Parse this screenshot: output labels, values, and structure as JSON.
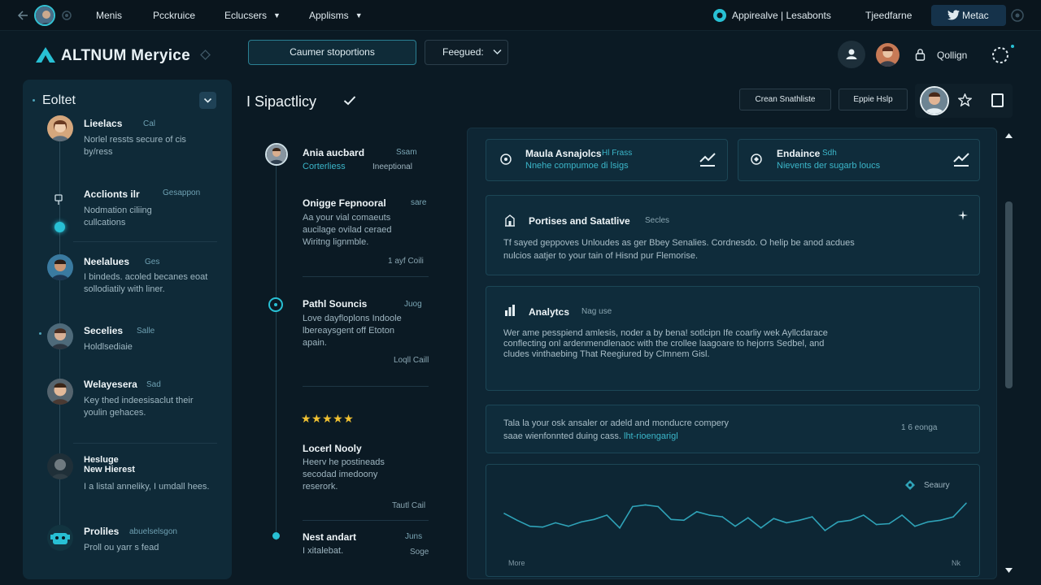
{
  "nav": {
    "items": [
      "Menis",
      "Pcckruice",
      "Eclucsers",
      "Applisms"
    ],
    "right_link": "Appirealve | Lesabonts",
    "right_link2": "Tjeedfarne",
    "twitter_label": "Metac"
  },
  "header": {
    "app_name": "ALTNUM Meryice",
    "primary_button": "Caumer stoportions",
    "select_label": "Feegued:",
    "login_label": "Qollign"
  },
  "sidebar": {
    "title": "Eoltet",
    "items": [
      {
        "name": "Lieelacs",
        "meta": "Cal",
        "desc": "Norlel ressts secure of cis by/ress"
      },
      {
        "name": "Acclionts ilr",
        "meta": "Gesappon",
        "desc": "Nodmation ciliing cullcations"
      },
      {
        "name": "Neelalues",
        "meta": "Ges",
        "desc": "I bindeds. acoled becanes eoat sollodiatily with liner."
      },
      {
        "name": "Secelies",
        "meta": "Salle",
        "desc": "Holdlsediaie"
      },
      {
        "name": "Welayesera",
        "meta": "Sad",
        "desc": "Key thed indeesisaclut their youlin gehaces."
      },
      {
        "name": "Hesluge",
        "name2": "New Hierest",
        "meta": "",
        "desc": "I a listal anneliky, I umdall hees."
      },
      {
        "name": "Proliles",
        "meta": "abuelselsgon",
        "desc": "Proll ou yarr s fead"
      }
    ]
  },
  "middle": {
    "title": "I Sipactlicy",
    "items": [
      {
        "head": "Ania aucbard",
        "meta": "Ssam",
        "sub": "Corterliess",
        "sub2": "Ineeptional"
      },
      {
        "head": "Onigge Fepnooral",
        "meta": "sare",
        "desc": "Aa your vial comaeuts aucilage ovilad ceraed Wiritng lignmble.",
        "foot": "1 ayf Coili"
      },
      {
        "head": "Pathl Souncis",
        "meta": "Juog",
        "desc": "Love dayfloplons Indoole lbereaysgent off Etoton apain.",
        "foot": "Loqll Caill"
      },
      {
        "rating": "★★★★★"
      },
      {
        "head": "Locerl Nooly",
        "desc": "Heerv he postineads secodad imedoony reserork.",
        "foot": "Tautl Cail"
      },
      {
        "head": "Nest andart",
        "meta": "Juns",
        "sub": "I xitalebat.",
        "foot": "Soge"
      }
    ]
  },
  "toolbar": {
    "btn1": "Crean Snathliste",
    "btn2": "Eppie Hslp"
  },
  "panel": {
    "card1": {
      "title": "Maula Asnajolcs",
      "meta": "Hl Frass",
      "sub": "Nnehe compumoe di lsigs"
    },
    "card2": {
      "title": "Endaince",
      "meta": "Sdh",
      "sub": "Nievents der sugarb loucs"
    },
    "card3": {
      "title": "Portises and Satatlive",
      "meta": "Secles",
      "text1": "Tf sayed geppoves Unloudes as ger Bbey Senalies. Cordnesdo. O helip be anod acdues",
      "text2": "nulcios aatjer to your tain of Hisnd pur Flemorise."
    },
    "card4": {
      "title": "Analytcs",
      "meta": "Nag use",
      "text": "Wer ame pesspiend amlesis, noder a by bena! sotlcipn Ife coarliy wek Ayllcdarace conflecting onl ardenmendlenaoc with the crollee laagoare to hejorrs Sedbel, and cludes vinthaebing That Reegiured by Clmnem Gisl."
    },
    "card5": {
      "text1": "Tala la your osk ansaler or adeld and monducre compery",
      "text2": "saae wienfonnted duing cass.",
      "link": "lht-rioengarigl",
      "meta": "1 6 eonga"
    },
    "chart": {
      "label": "Seaury",
      "footer_left": "More",
      "footer_right": "Nk"
    }
  },
  "chart_data": {
    "type": "line",
    "x": [
      1,
      2,
      3,
      4,
      5,
      6,
      7,
      8,
      9,
      10,
      11,
      12,
      13,
      14,
      15,
      16,
      17,
      18,
      19,
      20,
      21,
      22,
      23,
      24,
      25,
      26,
      27,
      28,
      29,
      30,
      31,
      32,
      33,
      34,
      35,
      36,
      37
    ],
    "values": [
      62,
      54,
      47,
      46,
      51,
      47,
      52,
      55,
      60,
      45,
      70,
      72,
      70,
      55,
      54,
      64,
      60,
      58,
      47,
      57,
      45,
      56,
      51,
      54,
      58,
      42,
      52,
      54,
      60,
      49,
      50,
      60,
      47,
      52,
      54,
      58,
      74
    ],
    "ylim": [
      0,
      100
    ],
    "series_color": "#2fa3b8"
  },
  "colors": {
    "accent": "#28c0d4",
    "star": "#f1c232",
    "background": "#0b1a24"
  }
}
